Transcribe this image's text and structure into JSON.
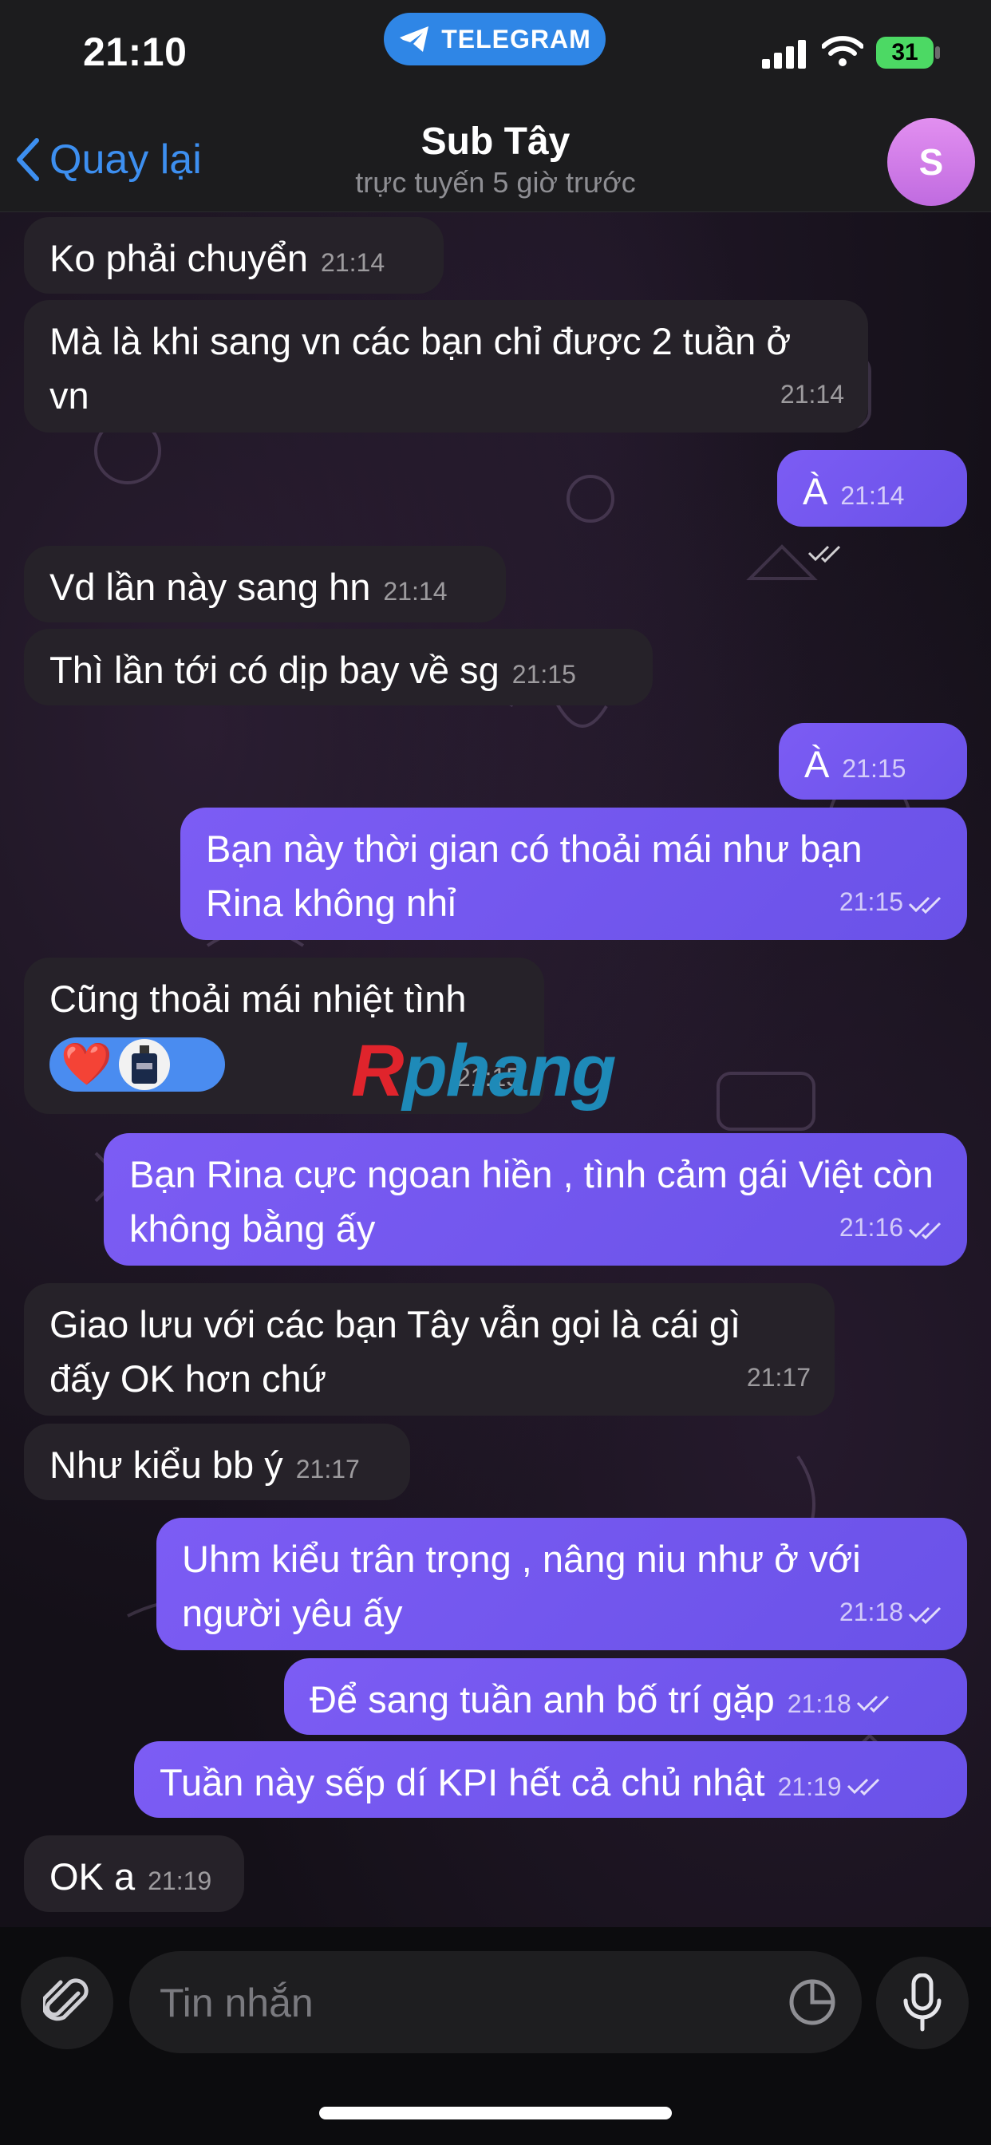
{
  "status_bar": {
    "time": "21:10",
    "app_pill": "TELEGRAM",
    "battery": "31"
  },
  "header": {
    "back_label": "Quay lại",
    "title": "Sub Tây",
    "subtitle": "trực tuyến 5 giờ trước",
    "avatar_letter": "S"
  },
  "messages": [
    {
      "dir": "in",
      "text": "Ko phải chuyển",
      "time": "21:14"
    },
    {
      "dir": "in",
      "text": "Mà là khi sang vn các bạn chỉ được 2 tuần ở vn",
      "time": "21:14"
    },
    {
      "dir": "out",
      "text": "À",
      "time": "21:14"
    },
    {
      "dir": "in",
      "text": "Vd lần này sang hn",
      "time": "21:14"
    },
    {
      "dir": "in",
      "text": "Thì lần tới có dịp bay về sg",
      "time": "21:15"
    },
    {
      "dir": "out",
      "text": "À",
      "time": "21:15"
    },
    {
      "dir": "out",
      "text": "Bạn này thời gian có thoải mái như bạn Rina không nhỉ",
      "time": "21:15"
    },
    {
      "dir": "in",
      "text": "Cũng thoải mái nhiệt tình",
      "time": "21:15",
      "reaction": "❤️"
    },
    {
      "dir": "out",
      "text": "Bạn Rina cực ngoan hiền , tình cảm gái Việt còn không bằng ấy",
      "time": "21:16"
    },
    {
      "dir": "in",
      "text": "Giao lưu với các bạn Tây vẫn gọi là cái gì đấy OK hơn chứ",
      "time": "21:17"
    },
    {
      "dir": "in",
      "text": "Như kiểu bb ý",
      "time": "21:17"
    },
    {
      "dir": "out",
      "text": "Uhm kiểu trân trọng , nâng niu như ở với người yêu ấy",
      "time": "21:18"
    },
    {
      "dir": "out",
      "text": "Để sang tuần anh bố trí gặp",
      "time": "21:18"
    },
    {
      "dir": "out",
      "text": "Tuần này sếp dí KPI hết cả chủ nhật",
      "time": "21:19"
    },
    {
      "dir": "in",
      "text": "OK a",
      "time": "21:19"
    }
  ],
  "watermark": {
    "first": "R",
    "rest": "phang"
  },
  "input": {
    "placeholder": "Tin nhắn"
  },
  "colors": {
    "outgoing_bubble": "#7c5cf4",
    "incoming_bubble": "#262229",
    "accent": "#3d8ff0"
  }
}
